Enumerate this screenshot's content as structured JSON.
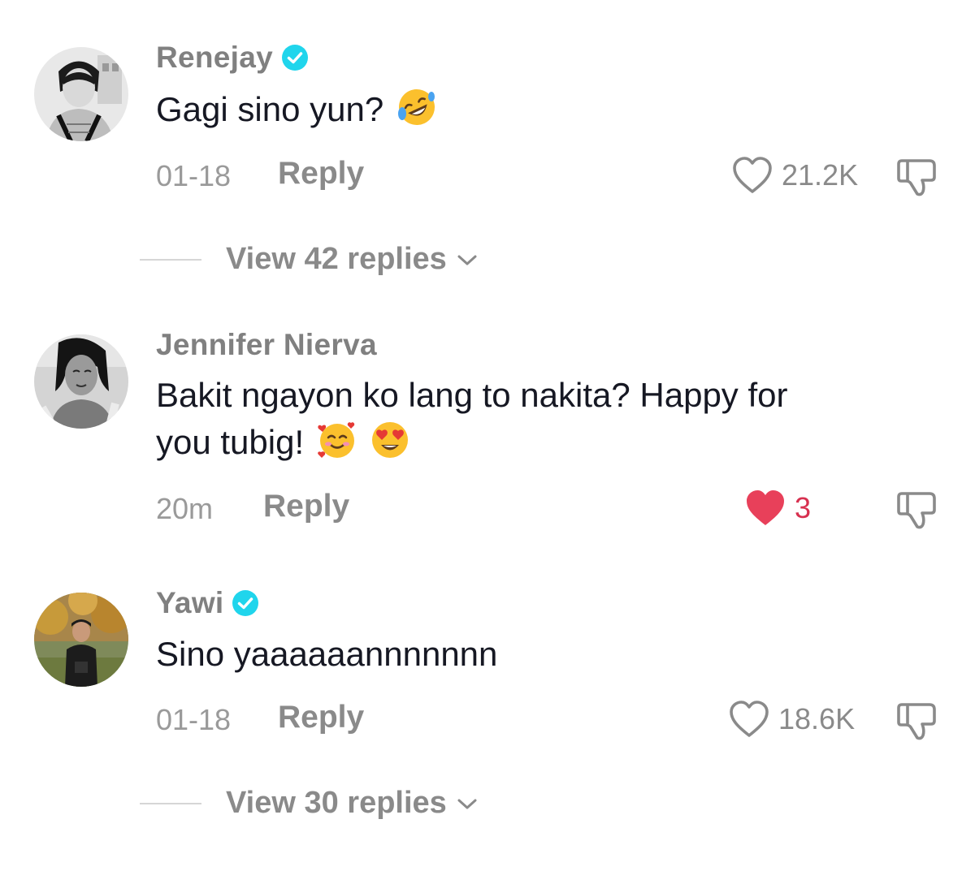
{
  "comments": [
    {
      "username": "Renejay",
      "verified": true,
      "text": "Gagi sino yun?",
      "emojis": [
        "rolling-on-floor-laughing-emoji"
      ],
      "time": "01-18",
      "reply_label": "Reply",
      "likes": "21.2K",
      "liked": false,
      "view_replies": "View 42 replies"
    },
    {
      "username": "Jennifer Nierva",
      "verified": false,
      "text_line1": "Bakit ngayon ko lang to nakita? Happy for",
      "text_line2": "you tubig!",
      "emojis": [
        "smiling-face-with-hearts-emoji",
        "heart-eyes-emoji"
      ],
      "time": "20m",
      "reply_label": "Reply",
      "likes": "3",
      "liked": true
    },
    {
      "username": "Yawi",
      "verified": true,
      "text": "Sino yaaaaaannnnnnn",
      "time": "01-18",
      "reply_label": "Reply",
      "likes": "18.6K",
      "liked": false,
      "view_replies": "View 30 replies"
    }
  ],
  "colors": {
    "username": "#808080",
    "text": "#161823",
    "meta": "#9a9a9a",
    "like_active": "#e8405a",
    "verified": "#20d5ec"
  },
  "icons": [
    "verified-badge-icon",
    "heart-outline-icon",
    "heart-filled-icon",
    "dislike-icon",
    "chevron-down-icon"
  ]
}
